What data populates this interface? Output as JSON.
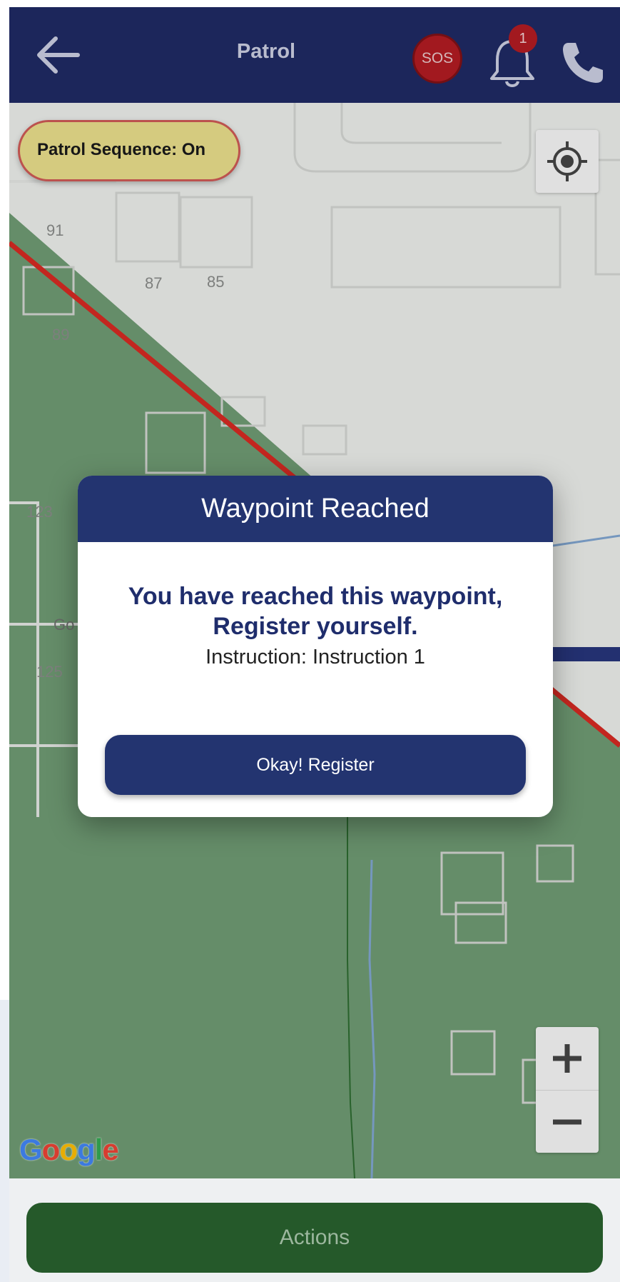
{
  "header": {
    "title": "Patrol",
    "back_icon": "arrow-left-icon",
    "sos_label": "SOS",
    "notification_count": "1",
    "bell_icon": "bell-icon",
    "phone_icon": "phone-icon",
    "bar_color": "#1f2a63"
  },
  "map": {
    "patrol_sequence_label": "Patrol Sequence: On",
    "house_numbers": [
      "91",
      "87",
      "85",
      "89",
      "123",
      "125"
    ],
    "partial_label": "Go",
    "google_logo": "Google",
    "locate_icon": "crosshair-locate-icon",
    "zoom_in_label": "+",
    "zoom_out_label": "−",
    "geofence_color": "#d42a22",
    "zone_fill_color": "#6e9a72"
  },
  "dialog": {
    "title": "Waypoint Reached",
    "message_line1": "You have reached this waypoint,",
    "message_line2": "Register yourself.",
    "instruction": "Instruction: Instruction 1",
    "button_label": "Okay! Register",
    "accent_color": "#233470"
  },
  "bottom_bar": {
    "actions_label": "Actions",
    "button_color": "#25592a"
  }
}
